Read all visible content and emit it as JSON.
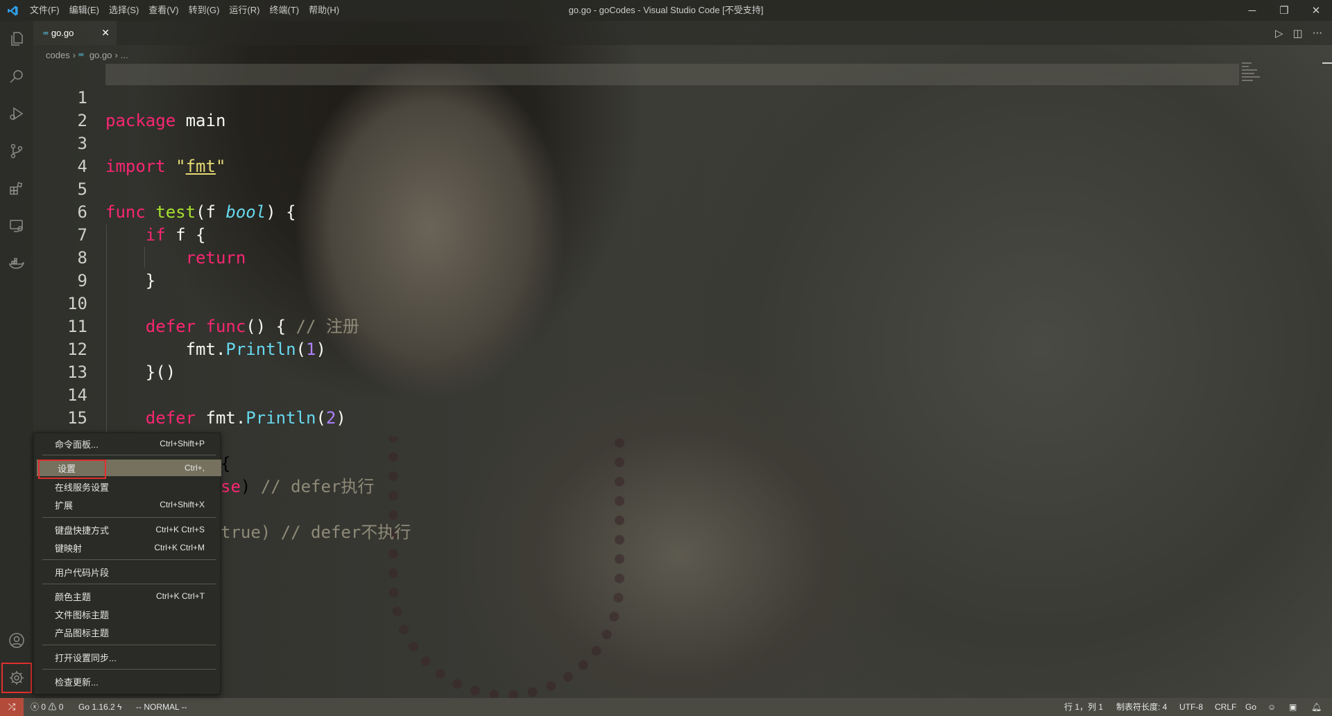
{
  "window": {
    "title": "go.go - goCodes - Visual Studio Code [不受支持]",
    "menu": [
      "文件(F)",
      "编辑(E)",
      "选择(S)",
      "查看(V)",
      "转到(G)",
      "运行(R)",
      "终端(T)",
      "帮助(H)"
    ]
  },
  "tab": {
    "label": "go.go",
    "close": "✕"
  },
  "breadcrumb": {
    "folder": "codes",
    "file": "go.go",
    "more": "..."
  },
  "editor": {
    "line_numbers": [
      "1",
      "2",
      "3",
      "4",
      "5",
      "6",
      "7",
      "8",
      "9",
      "10",
      "11",
      "12",
      "13",
      "14",
      "15",
      "16"
    ],
    "lines": {
      "l1_kw": "package",
      "l1_name": " main",
      "l3_kw": "import",
      "l3_str_open": " \"",
      "l3_str": "fmt",
      "l3_str_close": "\"",
      "l5_kw": "func",
      "l5_fn": " test",
      "l5_p1": "(f ",
      "l5_type": "bool",
      "l5_p2": ") {",
      "l6_kw": "if",
      "l6_rest": " f {",
      "l7_kw": "return",
      "l8": "}",
      "l10_kw": "defer",
      "l10_fn": " func",
      "l10_rest": "() { ",
      "l10_cmt": "// 注册",
      "l11_pkg": "fmt.",
      "l11_call": "Println",
      "l11_p1": "(",
      "l11_num": "1",
      "l11_p2": ")",
      "l12": "}()",
      "l14_kw": "defer",
      "l14_pkg": " fmt.",
      "l14_call": "Println",
      "l14_p1": "(",
      "l14_num": "2",
      "l14_p2": ")",
      "l16": "}",
      "l17_partial": "{",
      "l18_partial_kw": "se",
      "l18_partial_rest": ") ",
      "l18_cmt": "// defer执行",
      "l20_partial": "true) ",
      "l20_cmt": "// defer不执行"
    }
  },
  "context_menu": {
    "items": [
      {
        "label": "命令面板...",
        "shortcut": "Ctrl+Shift+P"
      },
      {
        "label": "设置",
        "shortcut": "Ctrl+,"
      },
      {
        "label": "在线服务设置",
        "shortcut": ""
      },
      {
        "label": "扩展",
        "shortcut": "Ctrl+Shift+X"
      },
      {
        "label": "键盘快捷方式",
        "shortcut": "Ctrl+K Ctrl+S"
      },
      {
        "label": "键映射",
        "shortcut": "Ctrl+K Ctrl+M"
      },
      {
        "label": "用户代码片段",
        "shortcut": ""
      },
      {
        "label": "颜色主题",
        "shortcut": "Ctrl+K Ctrl+T"
      },
      {
        "label": "文件图标主题",
        "shortcut": ""
      },
      {
        "label": "产品图标主题",
        "shortcut": ""
      },
      {
        "label": "打开设置同步...",
        "shortcut": ""
      },
      {
        "label": "检查更新...",
        "shortcut": ""
      }
    ]
  },
  "statusbar": {
    "errors": "0",
    "warnings": "0",
    "go_version": "Go 1.16.2",
    "vim_mode": "-- NORMAL --",
    "position": "行 1，列 1",
    "tab_size": "制表符长度: 4",
    "encoding": "UTF-8",
    "eol": "CRLF",
    "language": "Go"
  },
  "colors": {
    "keyword": "#f92672",
    "function": "#a6e22e",
    "type": "#66d9ef",
    "string": "#e6db74",
    "number": "#ae81ff",
    "comment": "#8f8a78",
    "highlight_outline": "#e0302e",
    "remote_button": "#b34b3b"
  },
  "icons": [
    "vscode-logo-icon",
    "explorer-icon",
    "search-icon",
    "run-debug-icon",
    "source-control-icon",
    "extensions-icon",
    "remote-explorer-icon",
    "docker-icon",
    "account-icon",
    "gear-icon",
    "run-icon",
    "split-editor-icon",
    "more-icon",
    "remote-icon",
    "error-icon",
    "warning-icon",
    "bell-icon"
  ]
}
